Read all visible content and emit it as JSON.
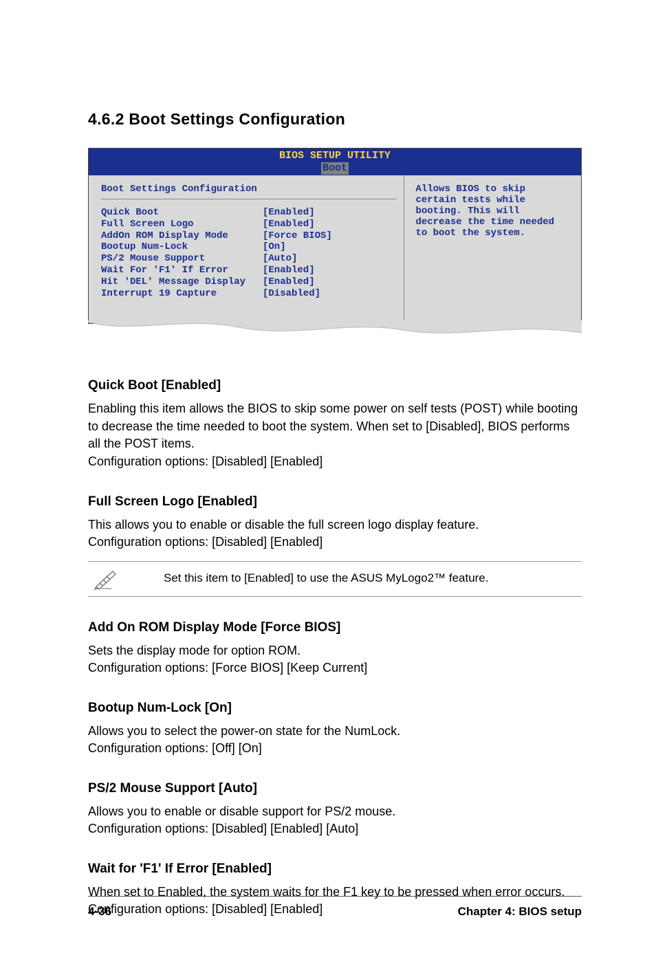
{
  "heading": "4.6.2   Boot Settings Configuration",
  "bios": {
    "title": "BIOS SETUP UTILITY",
    "tab": "Boot",
    "panelTitle": "Boot Settings Configuration",
    "rows": [
      {
        "label": "Quick Boot",
        "value": "[Enabled]"
      },
      {
        "label": "Full Screen Logo",
        "value": "[Enabled]"
      },
      {
        "label": "AddOn ROM Display Mode",
        "value": "[Force BIOS]"
      },
      {
        "label": "Bootup Num-Lock",
        "value": "[On]"
      },
      {
        "label": "PS/2 Mouse Support",
        "value": "[Auto]"
      },
      {
        "label": "Wait For 'F1' If Error",
        "value": "[Enabled]"
      },
      {
        "label": "Hit 'DEL' Message Display",
        "value": "[Enabled]"
      },
      {
        "label": "Interrupt 19 Capture",
        "value": "[Disabled]"
      }
    ],
    "help": "Allows BIOS to skip certain tests while booting. This will decrease the time needed to boot the system."
  },
  "items": [
    {
      "title": "Quick Boot [Enabled]",
      "body": "Enabling this item allows the BIOS to skip some power on self tests (POST) while booting to decrease the time needed to boot the system. When set to [Disabled], BIOS performs all the POST items.\nConfiguration options: [Disabled] [Enabled]"
    },
    {
      "title": "Full Screen Logo [Enabled]",
      "body": "This allows you to enable or disable the full screen logo display feature.\nConfiguration options: [Disabled] [Enabled]"
    }
  ],
  "noteText": "Set this item to [Enabled] to use the ASUS MyLogo2™ feature.",
  "items2": [
    {
      "title": "Add On ROM Display Mode [Force BIOS]",
      "body": "Sets the display mode for option ROM.\nConfiguration options: [Force BIOS] [Keep Current]"
    },
    {
      "title": "Bootup Num-Lock [On]",
      "body": "Allows you to select the power-on state for the NumLock.\nConfiguration options: [Off] [On]"
    },
    {
      "title": "PS/2 Mouse Support [Auto]",
      "body": "Allows you to enable or disable support for PS/2 mouse.\nConfiguration options: [Disabled] [Enabled] [Auto]"
    },
    {
      "title": "Wait for 'F1' If Error [Enabled]",
      "body": "When set to Enabled, the system waits for the F1 key to be pressed when error occurs. Configuration options: [Disabled] [Enabled]"
    }
  ],
  "footer": {
    "left": "4-36",
    "right": "Chapter 4: BIOS setup"
  }
}
